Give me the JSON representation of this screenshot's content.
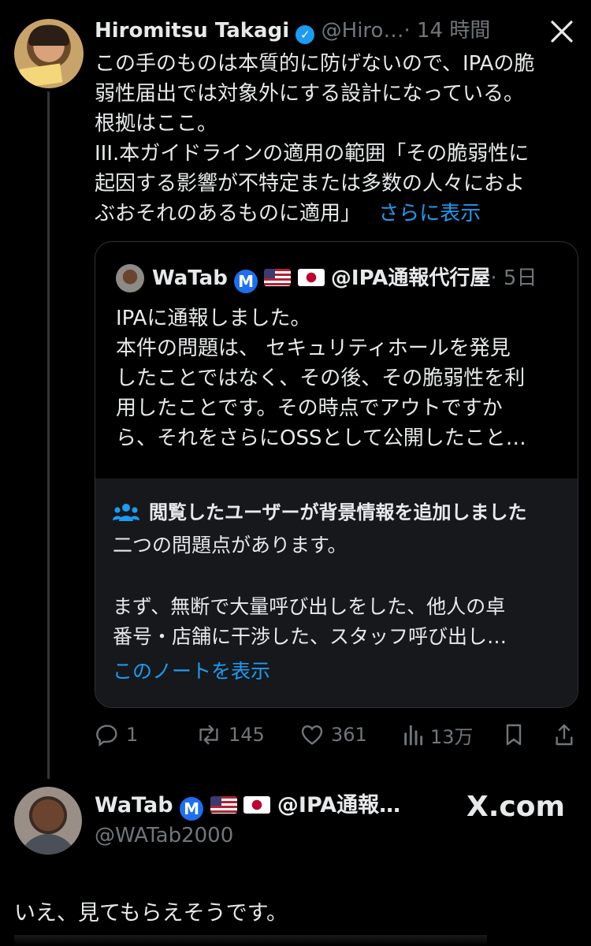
{
  "tweet": {
    "author_name": "Hiromitsu Takagi",
    "handle": "@Hiro…",
    "time": "· 14 時間",
    "body_lines": [
      "この手のものは本質的に防げないので、IPAの脆",
      "弱性届出では対象外にする設計になっている。",
      "根拠はここ。",
      "III.本ガイドラインの適用の範囲「その脆弱性に",
      "起因する影響が不特定または多数の人々におよ"
    ],
    "last_line": "ぶおそれのあるものに適用」",
    "show_more": "さらに表示"
  },
  "quote": {
    "author_name": "WaTab",
    "badge": "M",
    "handle": "@IPA通報代行屋",
    "time": "· 5日",
    "body_lines": [
      "IPAに通報しました。",
      "本件の問題は、 セキュリティホールを発見",
      "したことではなく、その後、その脆弱性を利",
      "用したことです。その時点でアウトですか",
      "ら、それをさらにOSSとして公開したこと…"
    ]
  },
  "community_note": {
    "title": "閲覧したユーザーが背景情報を追加しました",
    "line1": "二つの問題点があります。",
    "line2": "まず、無断で大量呼び出しをした、他人の卓",
    "line3": "番号・店舗に干渉した、スタッフ呼び出し…",
    "show_note": "このノートを表示"
  },
  "actions": {
    "reply_count": "1",
    "repost_count": "145",
    "like_count": "361",
    "views_count": "13万"
  },
  "next_tweet": {
    "author_name": "WaTab",
    "badge": "M",
    "handle_short": "@IPA通報…",
    "username": "@WATab2000",
    "brand": "X.com",
    "body": "いえ、見てもらえそうです。"
  },
  "colors": {
    "background": "#000000",
    "text": "#e7e9ea",
    "muted": "#71767b",
    "link": "#1d9bf0",
    "border": "#2f3336",
    "note_bg": "#16181c"
  },
  "icons": [
    "x-logo-icon",
    "verified-badge-icon",
    "reply-icon",
    "repost-icon",
    "like-icon",
    "views-icon",
    "bookmark-icon",
    "share-icon",
    "community-notes-icon"
  ]
}
